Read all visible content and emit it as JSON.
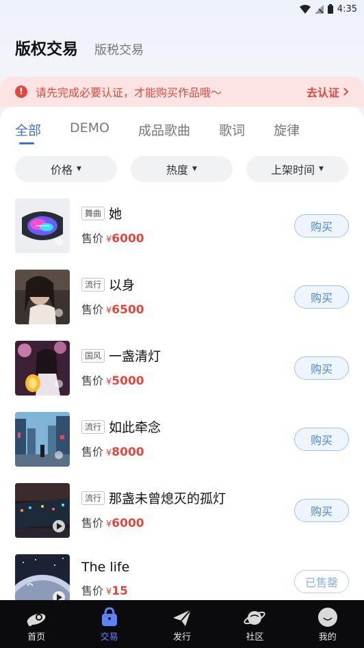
{
  "status_bar": {
    "time": "4:35"
  },
  "header": {
    "title": "版权交易",
    "subtitle": "版税交易"
  },
  "notice": {
    "text": "请先完成必要认证，才能购买作品哦～",
    "action": "去认证"
  },
  "tabs": [
    {
      "label": "全部",
      "active": true
    },
    {
      "label": "DEMO",
      "active": false
    },
    {
      "label": "成品歌曲",
      "active": false
    },
    {
      "label": "歌词",
      "active": false
    },
    {
      "label": "旋律",
      "active": false
    }
  ],
  "filters": [
    {
      "label": "价格"
    },
    {
      "label": "热度"
    },
    {
      "label": "上架时间"
    }
  ],
  "price_label": "售价",
  "currency": "¥",
  "items": [
    {
      "tag": "舞曲",
      "name": "她",
      "price": "6000",
      "button": "购买"
    },
    {
      "tag": "流行",
      "name": "以身",
      "price": "6500",
      "button": "购买"
    },
    {
      "tag": "国风",
      "name": "一盏清灯",
      "price": "5000",
      "button": "购买"
    },
    {
      "tag": "流行",
      "name": "如此牵念",
      "price": "8000",
      "button": "购买"
    },
    {
      "tag": "流行",
      "name": "那盏未曾熄灭的孤灯",
      "price": "6000",
      "button": "购买"
    },
    {
      "tag": "",
      "name": "The life",
      "price": "15",
      "button": "已售罄"
    }
  ],
  "bottom_nav": [
    {
      "label": "首页",
      "icon": "home-icon",
      "active": false
    },
    {
      "label": "交易",
      "icon": "bag-icon",
      "active": true
    },
    {
      "label": "发行",
      "icon": "paper-plane-icon",
      "active": false
    },
    {
      "label": "社区",
      "icon": "planet-icon",
      "active": false
    },
    {
      "label": "我的",
      "icon": "profile-icon",
      "active": false
    }
  ],
  "colors": {
    "accent": "#3f6fd8",
    "price": "#e0483e",
    "notice_bg": "#fde4e4",
    "nav_bg": "#0b0b0d"
  }
}
